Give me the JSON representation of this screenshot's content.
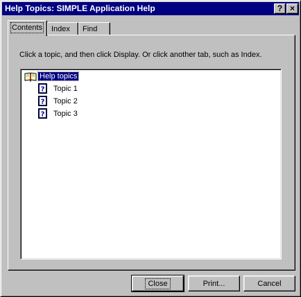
{
  "window": {
    "title": "Help Topics: SIMPLE Application Help",
    "help_button": "?",
    "close_button": "×"
  },
  "tabs": [
    {
      "label": "Contents",
      "active": true
    },
    {
      "label": "Index",
      "active": false
    },
    {
      "label": "Find",
      "active": false
    }
  ],
  "contents": {
    "instruction": "Click a topic, and then click Display. Or click another tab, such as Index.",
    "tree": {
      "root": {
        "label": "Help topics",
        "icon": "open-book-icon",
        "selected": true
      },
      "items": [
        {
          "label": "Topic 1",
          "icon": "help-page-icon"
        },
        {
          "label": "Topic 2",
          "icon": "help-page-icon"
        },
        {
          "label": "Topic 3",
          "icon": "help-page-icon"
        }
      ]
    }
  },
  "buttons": {
    "close": "Close",
    "print": "Print...",
    "cancel": "Cancel"
  },
  "colors": {
    "titlebar": "#000080",
    "face": "#c0c0c0",
    "selection": "#000080"
  }
}
